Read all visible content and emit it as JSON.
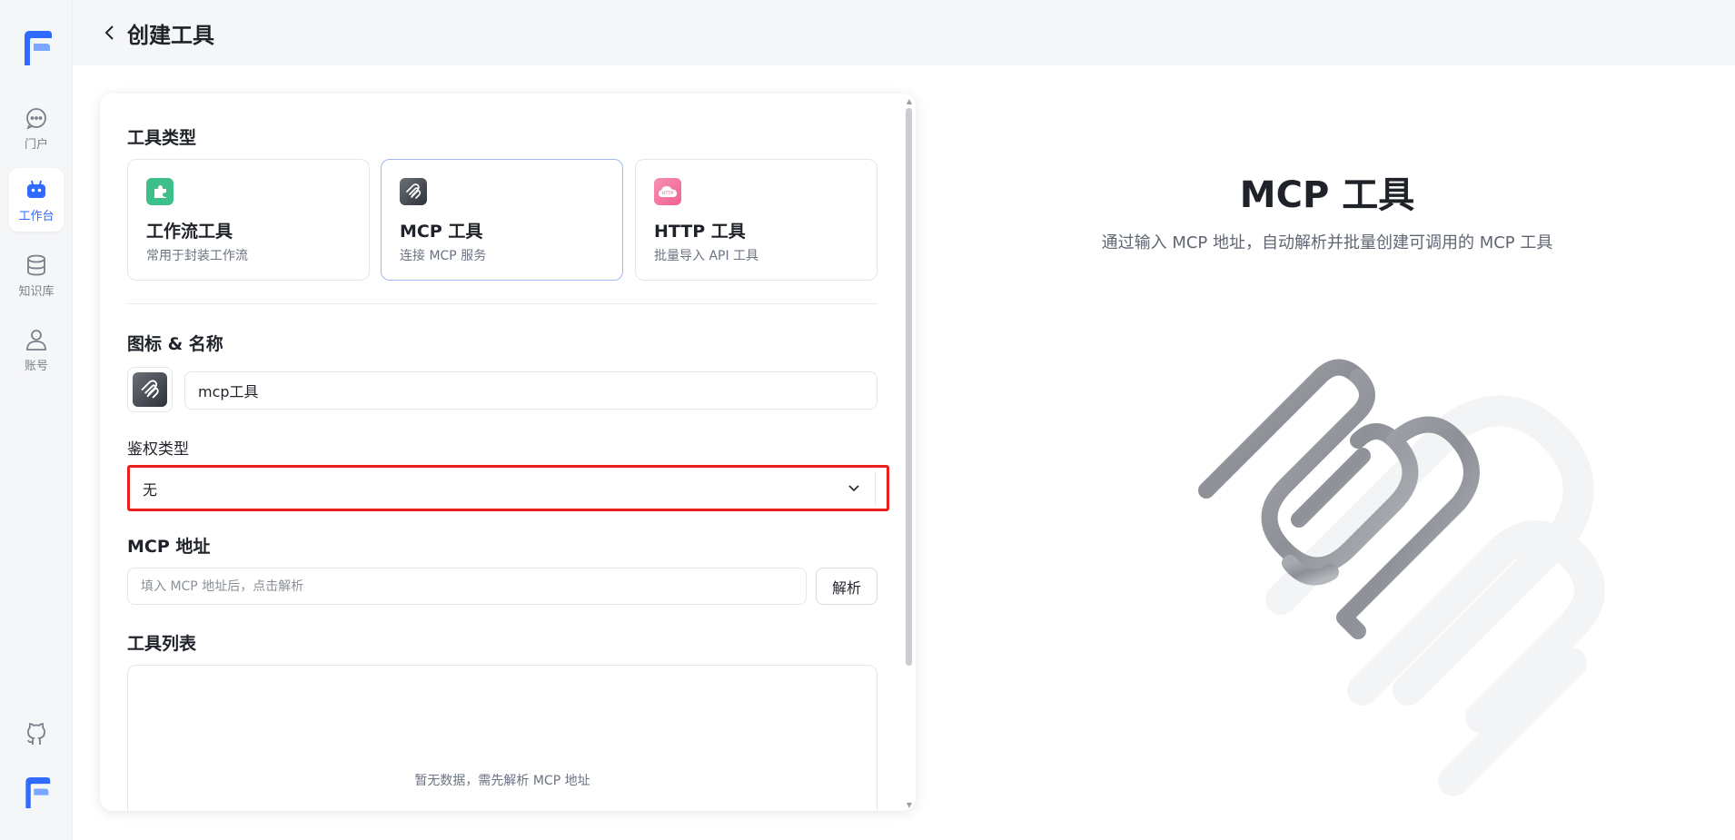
{
  "sidebar": {
    "items": [
      {
        "label": "门户",
        "icon": "chat-icon"
      },
      {
        "label": "工作台",
        "icon": "robot-icon",
        "active": true
      },
      {
        "label": "知识库",
        "icon": "database-icon"
      },
      {
        "label": "账号",
        "icon": "user-icon"
      }
    ]
  },
  "header": {
    "title": "创建工具"
  },
  "form": {
    "tool_type_label": "工具类型",
    "types": [
      {
        "name": "工作流工具",
        "desc": "常用于封装工作流",
        "icon": "puzzle-icon",
        "color": "#3dbf8a"
      },
      {
        "name": "MCP 工具",
        "desc": "连接 MCP 服务",
        "icon": "mcp-icon",
        "color": "#4b4f57",
        "selected": true
      },
      {
        "name": "HTTP 工具",
        "desc": "批量导入 API 工具",
        "icon": "http-cloud-icon",
        "color": "#f06292"
      }
    ],
    "icon_name_label": "图标 & 名称",
    "name_value": "mcp工具",
    "auth_label": "鉴权类型",
    "auth_value": "无",
    "mcp_label": "MCP 地址",
    "mcp_placeholder": "填入 MCP 地址后，点击解析",
    "parse_button": "解析",
    "tool_list_label": "工具列表",
    "tool_list_empty": "暂无数据，需先解析 MCP 地址"
  },
  "preview": {
    "title": "MCP 工具",
    "desc": "通过输入 MCP 地址，自动解析并批量创建可调用的 MCP 工具"
  },
  "colors": {
    "accent": "#2f6bff",
    "highlight_border": "#e8211d",
    "selected_border": "#9fb9f2"
  }
}
